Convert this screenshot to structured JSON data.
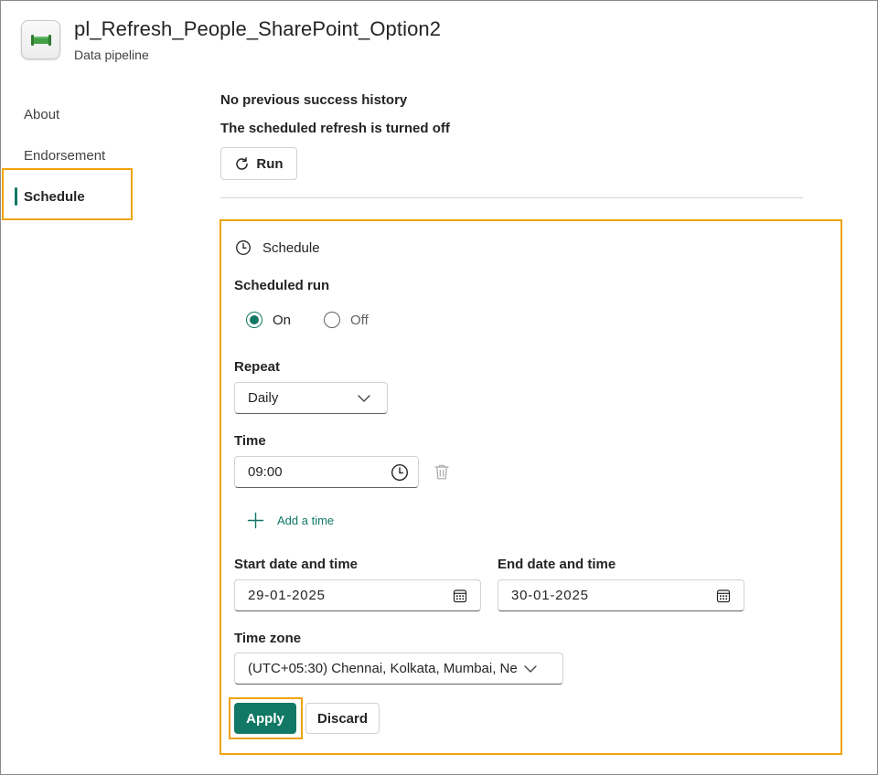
{
  "header": {
    "title": "pl_Refresh_People_SharePoint_Option2",
    "subtitle": "Data pipeline",
    "icon": "pipeline-icon"
  },
  "sidebar": {
    "items": [
      {
        "label": "About",
        "active": false
      },
      {
        "label": "Endorsement",
        "active": false
      },
      {
        "label": "Schedule",
        "active": true
      }
    ]
  },
  "status": {
    "history": "No previous success history",
    "refresh": "The scheduled refresh is turned off",
    "run_label": "Run"
  },
  "schedule": {
    "title": "Schedule",
    "scheduled_run_label": "Scheduled run",
    "on_label": "On",
    "off_label": "Off",
    "selected": "On",
    "repeat_label": "Repeat",
    "repeat_value": "Daily",
    "time_label": "Time",
    "time_value": "09:00",
    "add_time_label": "Add a time",
    "start_label": "Start date and time",
    "start_value": "29-01-2025",
    "end_label": "End date and time",
    "end_value": "30-01-2025",
    "timezone_label": "Time zone",
    "timezone_value": "(UTC+05:30) Chennai, Kolkata, Mumbai, Ne",
    "apply_label": "Apply",
    "discard_label": "Discard"
  },
  "colors": {
    "accent": "#117865",
    "highlight": "#f0a30a"
  }
}
